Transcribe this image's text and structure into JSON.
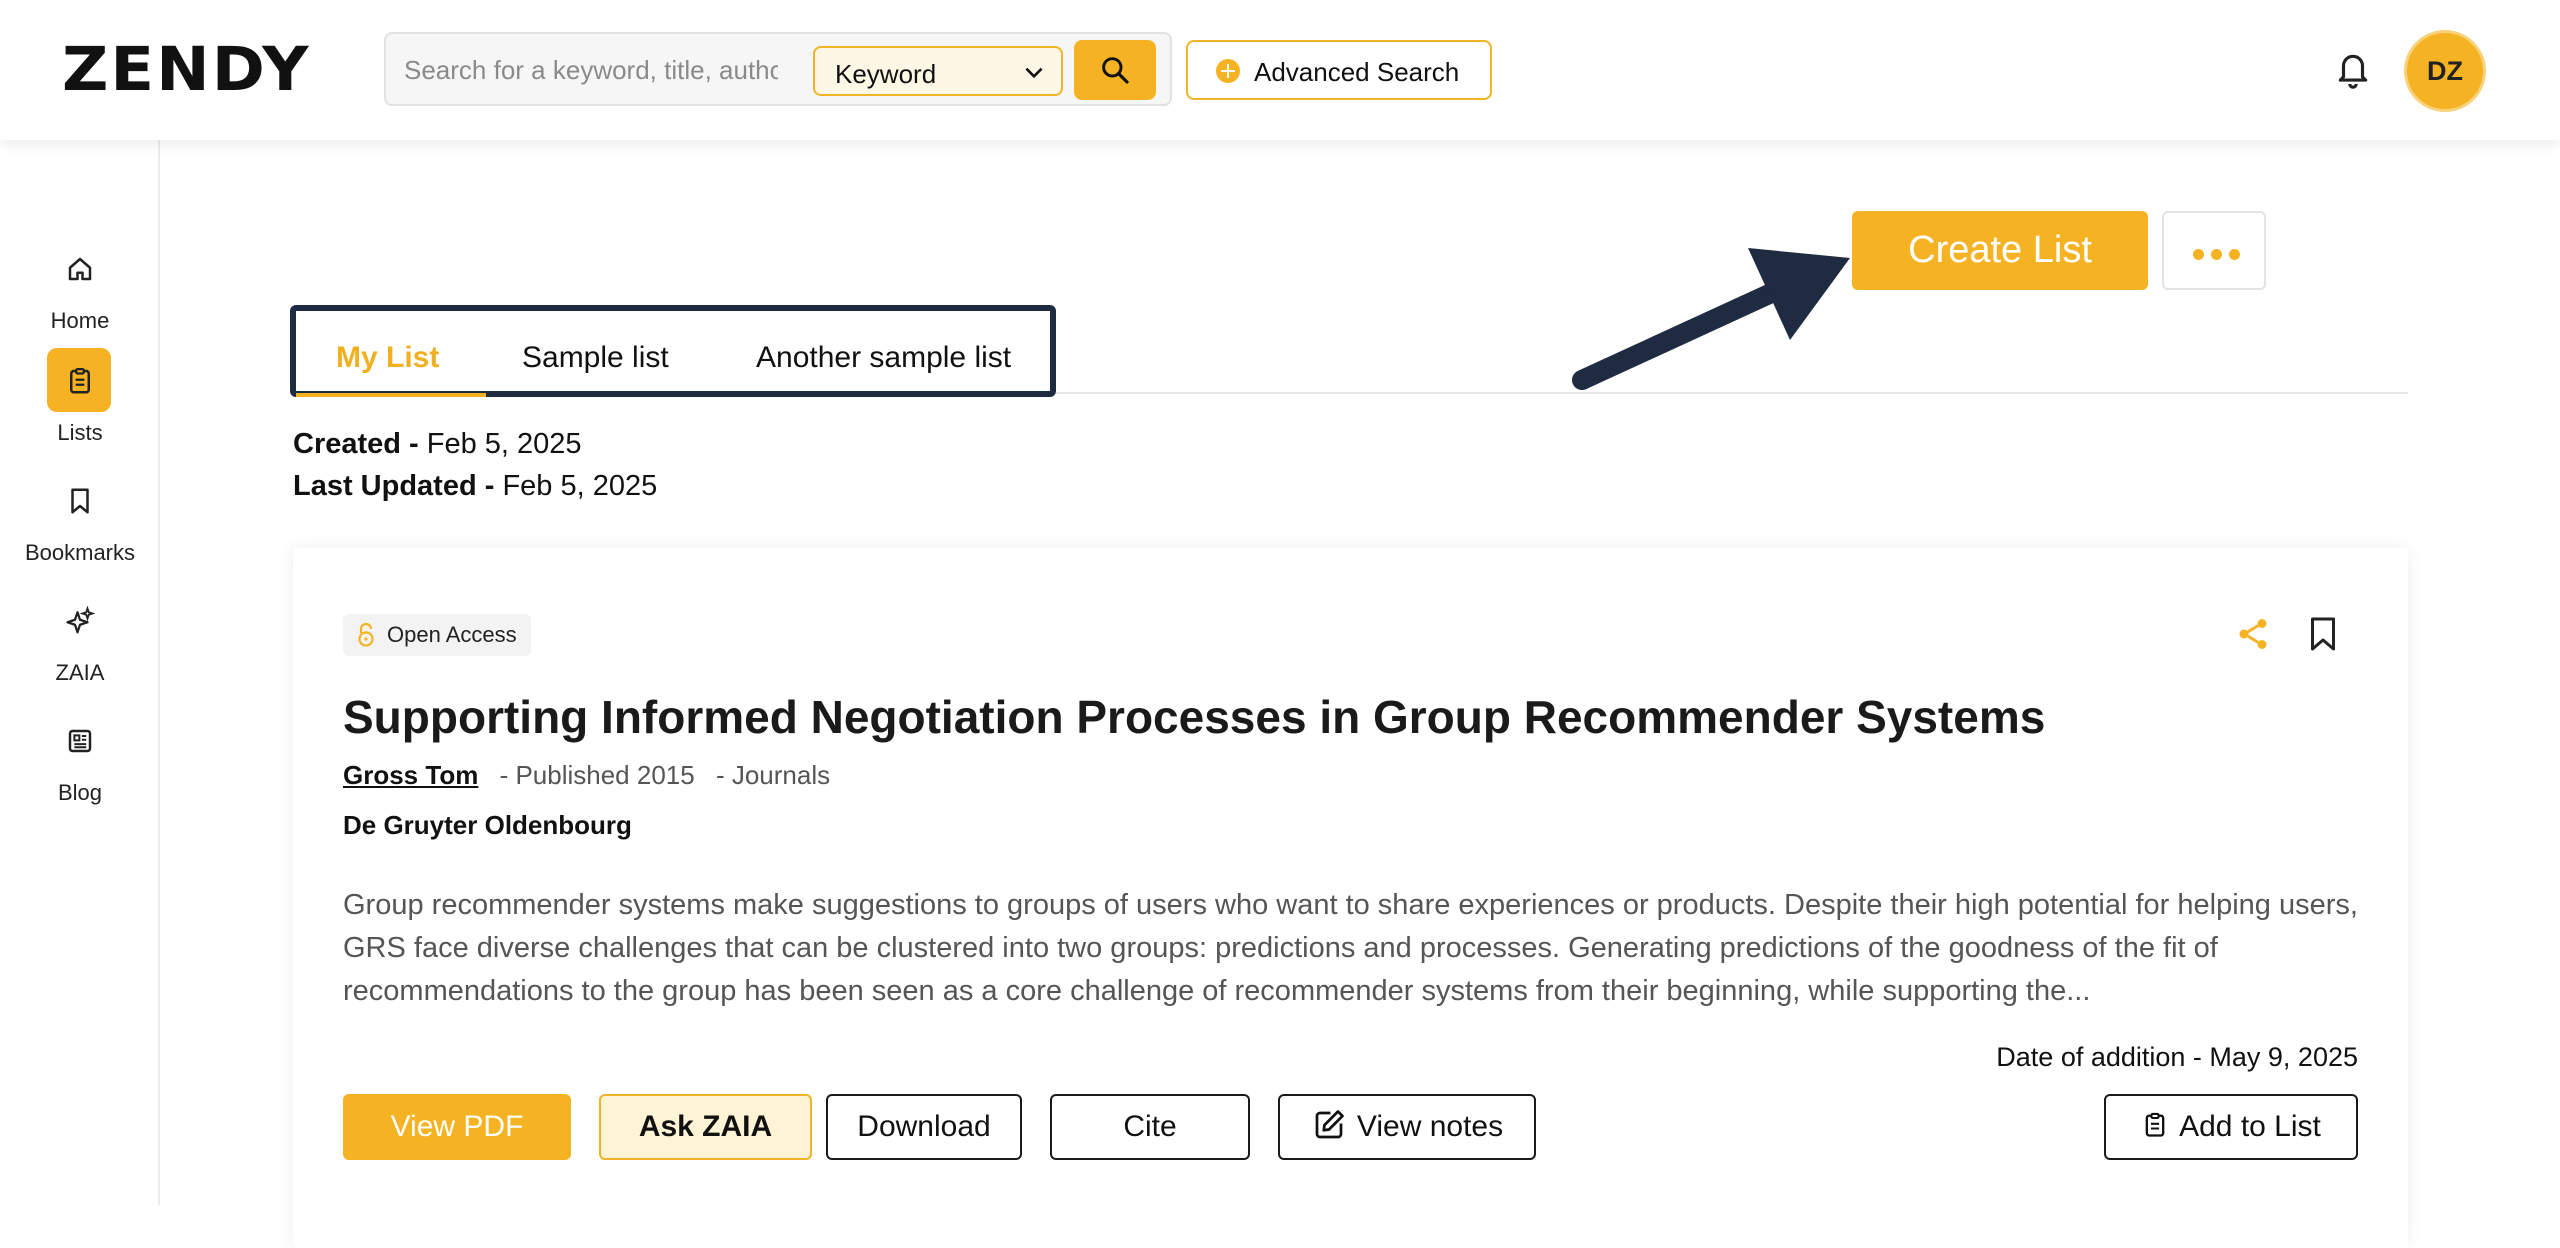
{
  "header": {
    "logo": "ZENDY",
    "search_placeholder": "Search for a keyword, title, author",
    "search_type": "Keyword",
    "advanced_search": "Advanced Search",
    "avatar_initials": "DZ"
  },
  "sidebar": {
    "items": [
      {
        "label": "Home",
        "icon": "home-icon"
      },
      {
        "label": "Lists",
        "icon": "clipboard-icon",
        "active": true
      },
      {
        "label": "Bookmarks",
        "icon": "bookmark-icon"
      },
      {
        "label": "ZAIA",
        "icon": "sparkles-icon"
      },
      {
        "label": "Blog",
        "icon": "newspaper-icon"
      }
    ]
  },
  "toolbar": {
    "create_list": "Create List"
  },
  "tabs": [
    {
      "label": "My List",
      "active": true
    },
    {
      "label": "Sample list"
    },
    {
      "label": "Another sample list"
    }
  ],
  "list_meta": {
    "created_label": "Created -",
    "created_value": "Feb 5, 2025",
    "updated_label": "Last Updated -",
    "updated_value": "Feb 5, 2025"
  },
  "article": {
    "badge": "Open Access",
    "title": "Supporting Informed Negotiation Processes in Group Recommender Systems",
    "author": "Gross Tom",
    "published": "- Published 2015",
    "type": "- Journals",
    "publisher": "De Gruyter Oldenbourg",
    "abstract": "Group recommender systems make suggestions to groups of users who want to share experiences or products. Despite their high potential for helping users, GRS face diverse challenges that can be clustered into two groups: predictions and processes. Generating predictions of the goodness of the fit of recommendations to the group has been seen as a core challenge of recommender systems from their beginning, while supporting the...",
    "date_added": "Date of addition - May 9, 2025",
    "actions": {
      "view_pdf": "View PDF",
      "ask_zaia": "Ask ZAIA",
      "download": "Download",
      "cite": "Cite",
      "view_notes": "View notes",
      "add_to_list": "Add to List"
    }
  },
  "colors": {
    "accent": "#f5b324",
    "frame": "#1e2b40"
  }
}
